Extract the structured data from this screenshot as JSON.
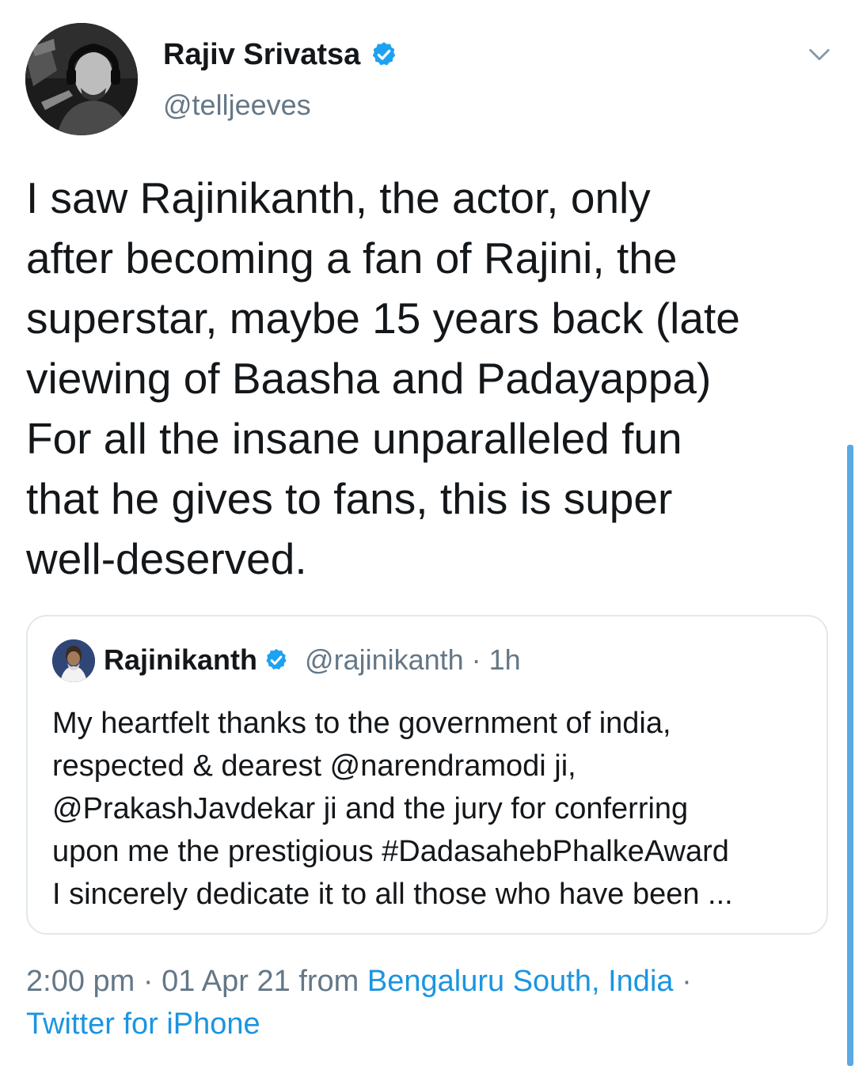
{
  "tweet": {
    "author": {
      "name": "Rajiv Srivatsa",
      "handle": "@telljeeves",
      "verified": true
    },
    "text": "I saw Rajinikanth, the actor, only\nafter becoming a fan of Rajini, the\nsuperstar, maybe 15 years back (late\nviewing of Baasha and Padayappa)\nFor all the insane unparalleled fun\nthat he gives to fans, this is super\nwell-deserved.",
    "quoted": {
      "name": "Rajinikanth",
      "handle_time": "@rajinikanth · 1h",
      "verified": true,
      "text": "My heartfelt thanks to the government of india,\nrespected & dearest @narendramodi ji,\n@PrakashJavdekar ji and the jury for conferring\nupon me the prestigious #DadasahebPhalkeAward\nI sincerely dedicate it to all those who have been ..."
    },
    "meta": {
      "time_date": "2:00 pm · 01 Apr 21 from ",
      "location": "Bengaluru South, India",
      "separator": " ·",
      "source": "Twitter for iPhone"
    }
  },
  "colors": {
    "text": "#14171a",
    "secondary": "#657786",
    "link": "#1b95e0",
    "verified": "#1da1f2",
    "border": "#e1e8ed"
  },
  "icons": [
    "verified-badge-icon",
    "chevron-down-icon"
  ]
}
